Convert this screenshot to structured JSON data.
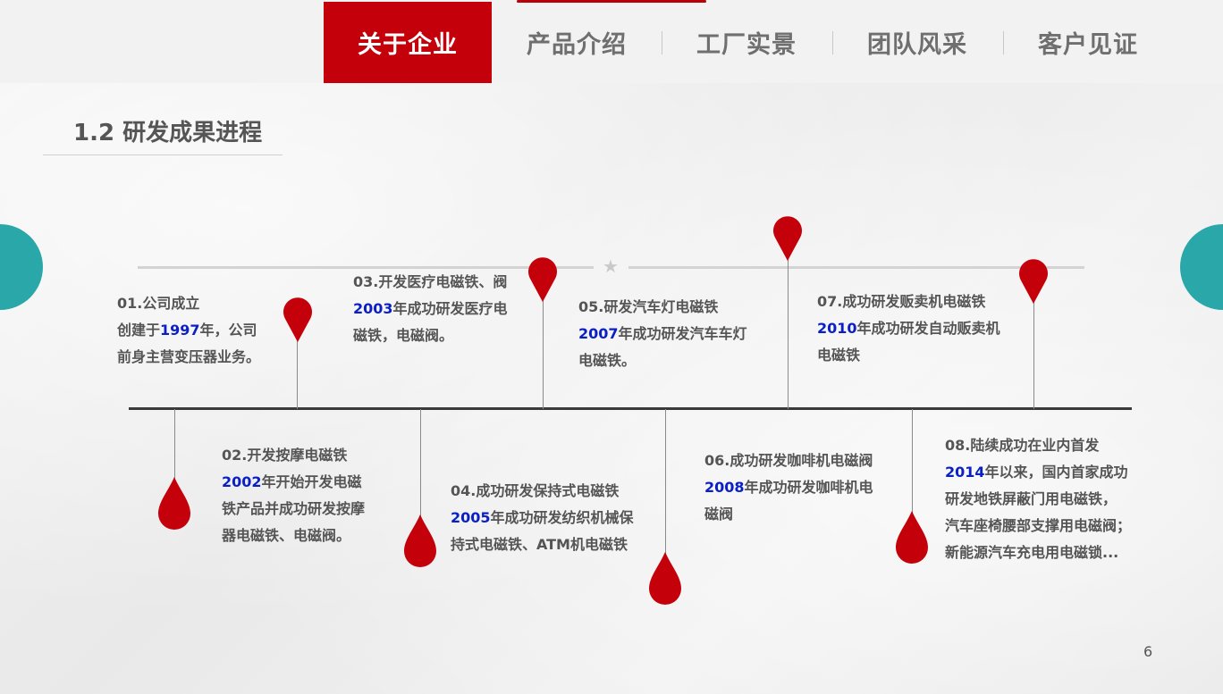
{
  "nav": {
    "tabs": [
      {
        "label": "关于企业",
        "active": true
      },
      {
        "label": "产品介绍",
        "active": false
      },
      {
        "label": "工厂实景",
        "active": false
      },
      {
        "label": "团队风采",
        "active": false
      },
      {
        "label": "客户见证",
        "active": false
      }
    ]
  },
  "section_title": "1.2 研发成果进程",
  "colors": {
    "accent": "#c4000b",
    "year": "#0a1fc4",
    "teal": "#2aa7a8"
  },
  "milestones": [
    {
      "head": "01.公司成立",
      "year": "1997",
      "lines": [
        "创建于",
        "年，公司",
        "前身主营变压器业务。"
      ]
    },
    {
      "head": "02.开发按摩电磁铁",
      "year": "2002",
      "lines": [
        "年开始开发电磁",
        "铁产品并成功研发按摩",
        "器电磁铁、电磁阀。"
      ]
    },
    {
      "head": "03.开发医疗电磁铁、阀",
      "year": "2003",
      "lines": [
        "年成功研发医疗电",
        "磁铁，电磁阀。"
      ]
    },
    {
      "head": "04.成功研发保持式电磁铁",
      "year": "2005",
      "lines": [
        "年成功研发纺织机械保",
        "持式电磁铁、ATM机电磁铁"
      ]
    },
    {
      "head": "05.研发汽车灯电磁铁",
      "year": "2007",
      "lines": [
        "年成功研发汽车车灯",
        "电磁铁。"
      ]
    },
    {
      "head": "06.成功研发咖啡机电磁阀",
      "year": "2008",
      "lines": [
        "年成功研发咖啡机电",
        "磁阀"
      ]
    },
    {
      "head": "07.成功研发贩卖机电磁铁",
      "year": "2010",
      "lines": [
        "年成功研发自动贩卖机",
        "电磁铁"
      ]
    },
    {
      "head": "08.陆续成功在业内首发",
      "year": "2014",
      "lines": [
        "年以来，国内首家成功",
        "研发地铁屏蔽门用电磁铁，",
        "汽车座椅腰部支撑用电磁阀；",
        "新能源汽车充电用电磁锁..."
      ]
    }
  ],
  "page_number": "6"
}
